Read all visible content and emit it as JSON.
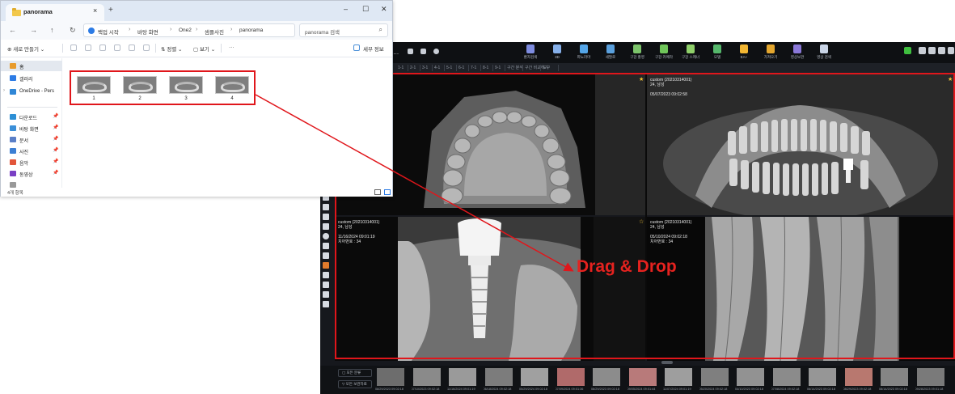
{
  "explorer": {
    "tab_title": "panorama",
    "tab_close": "×",
    "new_tab": "+",
    "window_buttons": [
      "–",
      "☐",
      "✕"
    ],
    "nav_buttons": [
      "←",
      "→",
      "↑",
      "↻"
    ],
    "breadcrumb": [
      "백업 시작",
      "바탕 화면",
      "One2",
      "샘플사진",
      "panorama"
    ],
    "crumb_sep": "›",
    "search_placeholder": "panorama 검색",
    "search_icon": "⌕",
    "commands": {
      "new": "⊕ 새로 만들기 ⌄",
      "sort": "⇅ 정렬 ⌄",
      "view": "▢ 보기 ⌄",
      "more": "···",
      "details": "세부 정보"
    },
    "sidebar": [
      {
        "label": "홈",
        "color": "#e89b2c",
        "active": true
      },
      {
        "label": "갤러리",
        "color": "#2c7be5"
      },
      {
        "label": "OneDrive - Pers",
        "color": "#2f86d6",
        "expander": "›"
      },
      {
        "label": "다운로드",
        "color": "#2d8fd5",
        "pin": "📌"
      },
      {
        "label": "바탕 화면",
        "color": "#3b8fd8",
        "pin": "📌"
      },
      {
        "label": "문서",
        "color": "#5a7fc7",
        "pin": "📌"
      },
      {
        "label": "사진",
        "color": "#3c7fd4",
        "pin": "📌"
      },
      {
        "label": "음악",
        "color": "#e2553a",
        "pin": "📌"
      },
      {
        "label": "동영상",
        "color": "#7a3fc4",
        "pin": "📌"
      },
      {
        "label": "",
        "color": "#999999"
      }
    ],
    "files": [
      {
        "name": "1"
      },
      {
        "name": "2"
      },
      {
        "name": "3"
      },
      {
        "name": "4"
      }
    ],
    "status": "4개 항목"
  },
  "viewer": {
    "toolbar_left": "2...",
    "tools": [
      {
        "label": "환자검색",
        "color": "#7e8ce0"
      },
      {
        "label": "3D",
        "color": "#86b0ea"
      },
      {
        "label": "파노라마",
        "color": "#55a6e8"
      },
      {
        "label": "세팔로",
        "color": "#5aa0dd"
      },
      {
        "label": "구강 촬영",
        "color": "#7cc46b"
      },
      {
        "label": "구강 카메라",
        "color": "#6fc55a"
      },
      {
        "label": "구강 스캐너",
        "color": "#8fd06a"
      },
      {
        "label": "모델",
        "color": "#56b86c"
      },
      {
        "label": "EA+",
        "color": "#f2b632"
      },
      {
        "label": "가져오기",
        "color": "#e3a62e"
      },
      {
        "label": "영상보관",
        "color": "#8a78d8"
      },
      {
        "label": "영상 검색",
        "color": "#c9d4e6"
      }
    ],
    "subbar": [
      "1-1",
      "2-1",
      "3-1",
      "4-1",
      "5-1",
      "6-1",
      "7-1",
      "8-1",
      "9-1",
      "구간 분석",
      "구간 비교하기",
      "도구"
    ],
    "panes": [
      {
        "info": "",
        "star": "★"
      },
      {
        "info": "custom (20210314001)\n24, 남성\n\n05/07/2023 09:02:58",
        "star": "★"
      },
      {
        "info": "custom (20210314001)\n24, 남성\n\n11/16/2024 09:01:19\n치아번호 : 34",
        "star": "☆"
      },
      {
        "info": "custom (20210314001)\n24, 남성\n\n05/10/2024 09:02:18\n치아번호 : 34",
        "star": ""
      }
    ],
    "drag_drop_label": "Drag & Drop",
    "strip_filters": [
      "▢ 모든 분류",
      "▽ 모든 보관자료"
    ],
    "thumb_captions": [
      "08/29/2023 09:02:18",
      "07/10/2023 09:02:18",
      "11/16/2024 09:01:19",
      "06/18/2024 09:02:18",
      "05/29/2024 09:02:18",
      "07/09/2024 09:01:36",
      "08/29/2023 09:02:18",
      "09/05/2024 09:01:44",
      "11/07/2024 09:01:19",
      "05/20/2024 09:02:18",
      "04/10/2023 09:02:18",
      "07/08/2024 09:02:18",
      "06/14/2023 09:02:18",
      "08/29/2023 09:02:18",
      "08/14/2023 09:02:18",
      "09/28/2023 09:01:18"
    ]
  },
  "colors": {
    "highlight_red": "#e0161b",
    "viewer_bg": "#16181d",
    "explorer_accent": "#2c7be5"
  }
}
